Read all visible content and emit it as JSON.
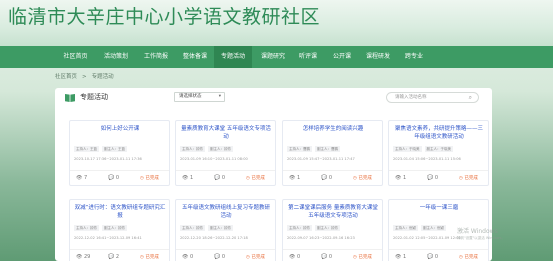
{
  "site": {
    "title": "临清市大辛庄中心小学语文教研社区"
  },
  "nav": [
    {
      "label": "社区首页",
      "active": false
    },
    {
      "label": "活动策划",
      "active": false
    },
    {
      "label": "工作简报",
      "active": false
    },
    {
      "label": "整体备课",
      "active": false
    },
    {
      "label": "专题活动",
      "active": true
    },
    {
      "label": "课题研究",
      "active": false
    },
    {
      "label": "听评课",
      "active": false
    },
    {
      "label": "公开课",
      "active": false
    },
    {
      "label": "课程研发",
      "active": false
    },
    {
      "label": "跨专业",
      "active": false
    }
  ],
  "breadcrumb": [
    "社区首页",
    ">",
    "专题活动"
  ],
  "panel": {
    "title": "专题活动",
    "select_value": "请选择状态",
    "search_placeholder": "请输入活动名称"
  },
  "cards": [
    {
      "title": "如何上好公开课",
      "tags": [
        "主持人：王蓝",
        "副主人：王蓝"
      ],
      "time": "2023-10-17 17:36~2023-01-11 17:36",
      "views": "7",
      "comments": "0",
      "status": "已完成"
    },
    {
      "title": "量素质教育大课堂 五年级语文专项活动",
      "tags": [
        "主持人：钟芳",
        "副主人：钟芳"
      ],
      "time": "2023-01-09 16:10~2023-01-11 08:00",
      "views": "1",
      "comments": "0",
      "status": "已完成"
    },
    {
      "title": "怎样培养学生的阅读兴趣",
      "tags": [
        "主持人：曹鹏",
        "副主人：曹鹏"
      ],
      "time": "2023-01-09 15:47~2023-01-11 17:47",
      "views": "1",
      "comments": "0",
      "status": "已完成"
    },
    {
      "title": "聚焦语文素养，共研提升策略——三年级组语文教研活动",
      "tags": [
        "主持人：于晓美",
        "副主人：于晓美"
      ],
      "time": "2023-01-04 15:06~2023-01-11 15:06",
      "views": "1",
      "comments": "0",
      "status": "已完成"
    },
    {
      "title": "双减”进行时：语文教研组专题研究汇报",
      "tags": [
        "主持人：钟芳",
        "副主人：钟芳"
      ],
      "time": "2022-12-02 16:41~2023-12-09 16:41",
      "views": "29",
      "comments": "2",
      "status": "已完成"
    },
    {
      "title": "五年级语文教研组线上复习专题教研活动",
      "tags": [
        "主持人：钟芳",
        "副主人：钟芳"
      ],
      "time": "2022-12-20 18:26~2022-12-20 17:18",
      "views": "0",
      "comments": "0",
      "status": "已完成"
    },
    {
      "title": "第二课堂课后服务 量素质教育大课堂 五年级语文专项活动",
      "tags": [
        "主持人：钟芳",
        "副主人：钟芳"
      ],
      "time": "2022-09-07 16:23~2022-09-16 16:23",
      "views": "0",
      "comments": "0",
      "status": "已完成"
    },
    {
      "title": "一年级一课三磨",
      "tags": [
        "主持人：倪颖",
        "副主人：倪颖"
      ],
      "time": "2022-01-02 12:05~2022-01-09 12:05",
      "views": "1",
      "comments": "0",
      "status": "已完成"
    }
  ],
  "watermark": {
    "line1": "激活 Windows",
    "line2": "转到\"设置\"以激活 Windows。"
  },
  "colors": {
    "nav_bg": "#3d9b64",
    "title": "#2e8b57",
    "card_title": "#2d54c8",
    "status": "#e86d3a"
  },
  "icons": {
    "panel": "book-icon",
    "views": "eye-icon",
    "comments": "comment-icon",
    "status": "clock-icon",
    "search": "search-icon"
  }
}
